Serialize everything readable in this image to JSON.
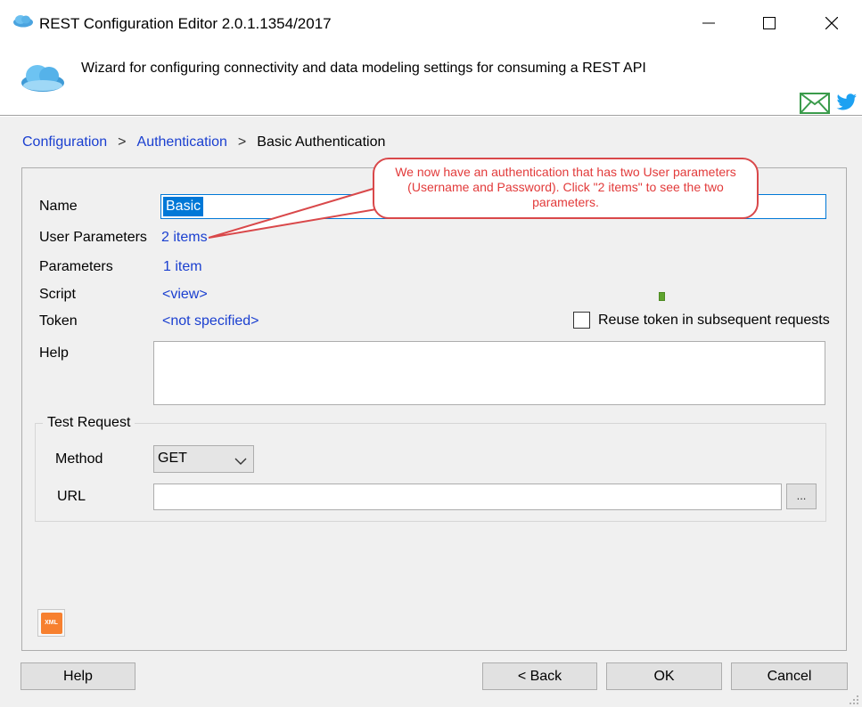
{
  "window": {
    "title": "REST Configuration Editor 2.0.1.1354/2017"
  },
  "header": {
    "description": "Wizard for configuring connectivity and data modeling settings for consuming a REST API"
  },
  "breadcrumb": {
    "items": [
      "Configuration",
      "Authentication"
    ],
    "separator": ">",
    "current": "Basic Authentication"
  },
  "form": {
    "name_label": "Name",
    "name_value": "Basic",
    "user_params_label": "User Parameters",
    "user_params_value": "2 items",
    "params_label": "Parameters",
    "params_value": "1 item",
    "script_label": "Script",
    "script_value": "<view>",
    "token_label": "Token",
    "token_value": "<not specified>",
    "reuse_token_label": "Reuse token in subsequent requests",
    "reuse_token_checked": false,
    "help_label": "Help",
    "help_value": ""
  },
  "test_request": {
    "group_title": "Test Request",
    "method_label": "Method",
    "method_value": "GET",
    "url_label": "URL",
    "url_value": "",
    "browse_label": "..."
  },
  "buttons": {
    "help": "Help",
    "back": "< Back",
    "ok": "OK",
    "cancel": "Cancel"
  },
  "xml_icon_text": "XML",
  "callout": {
    "text": "We now have an authentication that has two User parameters (Username and Password). Click \"2 items\" to see the two parameters."
  },
  "colors": {
    "link": "#1a3fd0",
    "callout_border": "#d9484a",
    "callout_text": "#e23a3a",
    "selection": "#0078d7"
  }
}
